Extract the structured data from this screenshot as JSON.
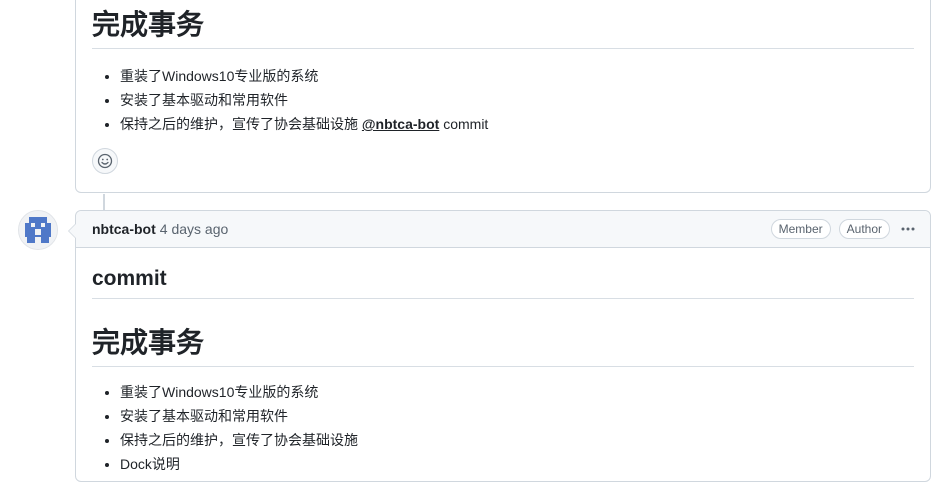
{
  "comment1": {
    "heading": "完成事务",
    "items": [
      "重装了Windows10专业版的系统",
      "安装了基本驱动和常用软件",
      "保持之后的维护，宣传了协会基础设施 "
    ],
    "mention": "@nbtca-bot",
    "mention_suffix": " commit",
    "reaction_icon": "smiley-icon"
  },
  "comment2": {
    "author": "nbtca-bot",
    "timestamp": "4 days ago",
    "badges": [
      "Member",
      "Author"
    ],
    "menu_icon": "kebab-horizontal-icon",
    "title": "commit",
    "heading": "完成事务",
    "items": [
      "重装了Windows10专业版的系统",
      "安装了基本驱动和常用软件",
      "保持之后的维护，宣传了协会基础设施",
      "Dock说明"
    ]
  },
  "colors": {
    "border": "#d0d7de",
    "header_bg": "#f6f8fa",
    "text": "#1f2328",
    "muted": "#59636e",
    "avatar": "#4f78c8"
  }
}
